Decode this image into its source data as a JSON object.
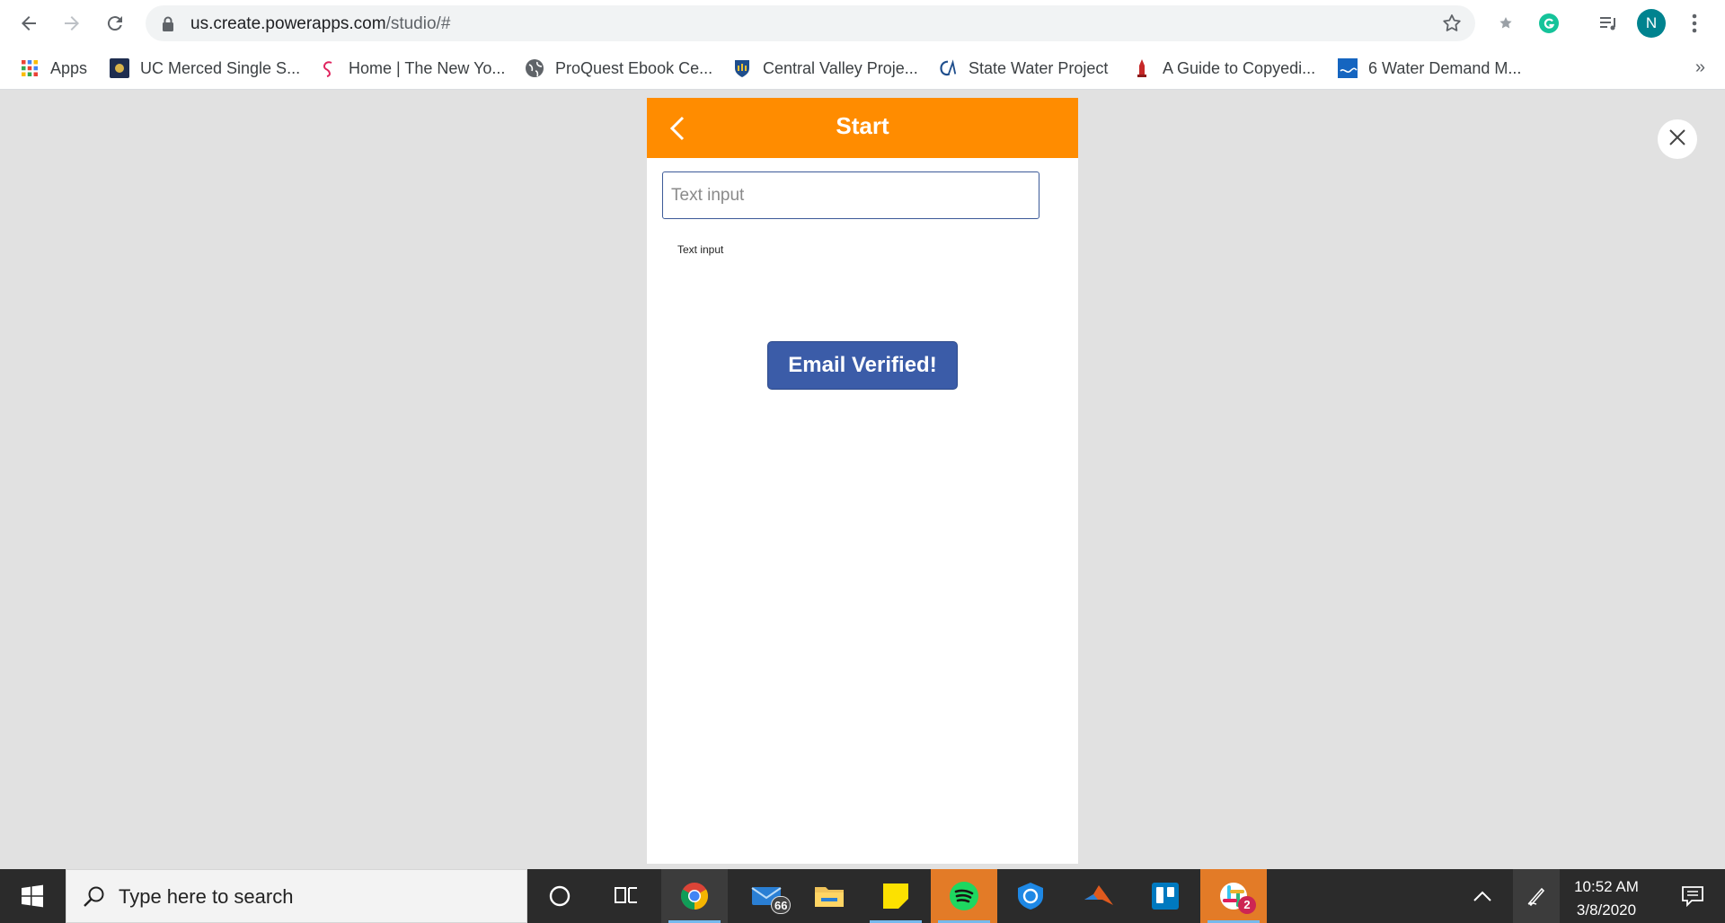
{
  "browser": {
    "url_host": "us.create.powerapps.com",
    "url_path": "/studio/#",
    "profile_initial": "N",
    "bookmarks": [
      {
        "label": "Apps",
        "icon": "apps-grid-icon"
      },
      {
        "label": "UC Merced Single S...",
        "icon": "ucm-icon"
      },
      {
        "label": "Home | The New Yo...",
        "icon": "swirl-icon"
      },
      {
        "label": "ProQuest Ebook Ce...",
        "icon": "globe-icon"
      },
      {
        "label": "Central Valley Proje...",
        "icon": "shield-icon"
      },
      {
        "label": "State Water Project",
        "icon": "ca-icon"
      },
      {
        "label": "A Guide to Copyedi...",
        "icon": "tower-icon"
      },
      {
        "label": "6 Water Demand M...",
        "icon": "usgs-icon"
      }
    ],
    "bookmarks_more": "»"
  },
  "app": {
    "title": "Start",
    "text_input_placeholder": "Text input",
    "text_label": "Text input",
    "verify_button_label": "Email Verified!",
    "colors": {
      "header": "#ff8c00",
      "button": "#3b5ca8"
    }
  },
  "taskbar": {
    "search_placeholder": "Type here to search",
    "mail_badge": "66",
    "slack_badge": "2",
    "time": "10:52 AM",
    "date": "3/8/2020"
  }
}
